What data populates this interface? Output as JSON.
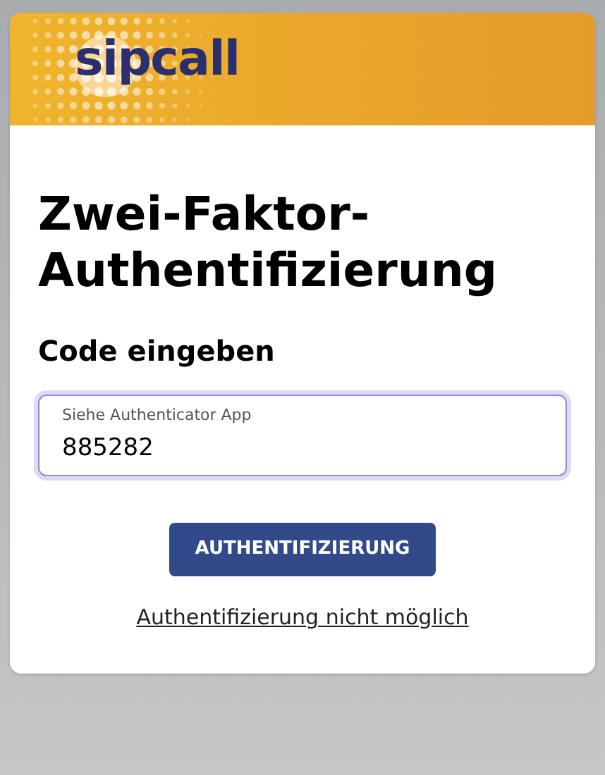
{
  "header": {
    "logo": "sipcall"
  },
  "title": "Zwei-Faktor-Authentifizierung",
  "subtitle": "Code eingeben",
  "code_field": {
    "label": "Siehe Authenticator App",
    "value": "885282",
    "focused": true
  },
  "submit_button": "AUTHENTIFIZIERUNG",
  "help_link": "Authentifizierung nicht möglich"
}
